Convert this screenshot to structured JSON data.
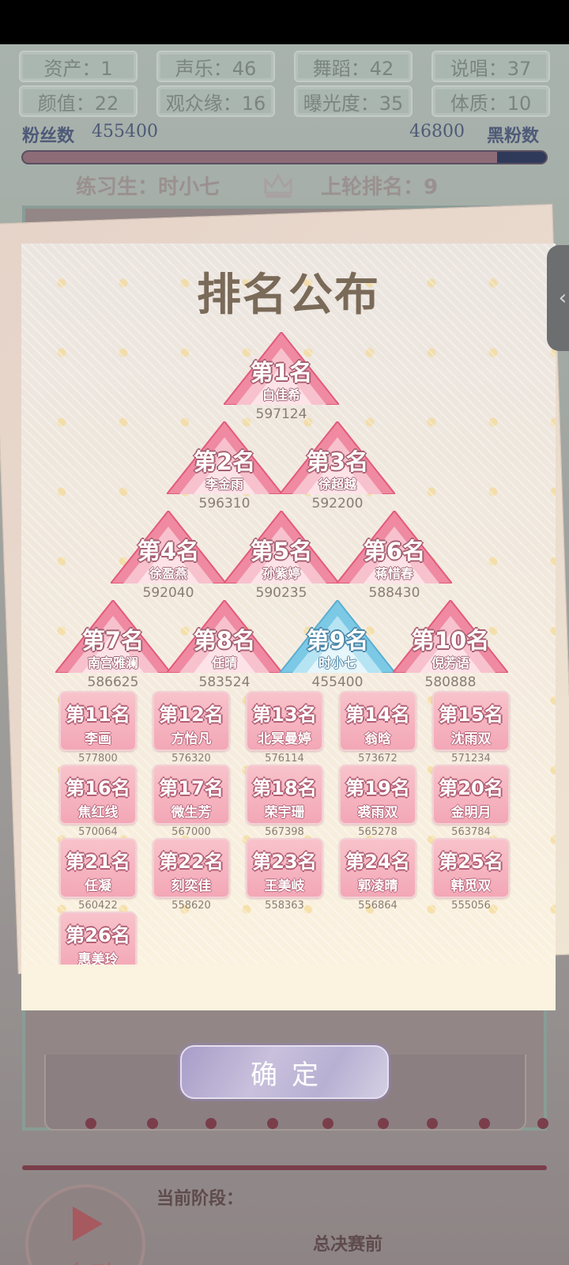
{
  "stats": [
    {
      "label": "资产：1"
    },
    {
      "label": "声乐：46"
    },
    {
      "label": "舞蹈：42"
    },
    {
      "label": "说唱：37"
    },
    {
      "label": "颜值：22"
    },
    {
      "label": "观众缘：16"
    },
    {
      "label": "曝光度：35"
    },
    {
      "label": "体质：10"
    }
  ],
  "fans": {
    "label": "粉丝数",
    "value": "455400",
    "anti_value": "46800",
    "anti_label": "黑粉数",
    "fan_fraction": 0.907
  },
  "trainee": {
    "name_label": "练习生：时小七",
    "last_rank_label": "上轮排名：9"
  },
  "ranking": {
    "title": "排名公布",
    "triangles": [
      {
        "rank": "第1名",
        "name": "白佳希",
        "score": "597124",
        "highlight": false
      },
      {
        "rank": "第2名",
        "name": "李金雨",
        "score": "596310",
        "highlight": false
      },
      {
        "rank": "第3名",
        "name": "徐超越",
        "score": "592200",
        "highlight": false
      },
      {
        "rank": "第4名",
        "name": "徐盈燕",
        "score": "592040",
        "highlight": false
      },
      {
        "rank": "第5名",
        "name": "孙紫婷",
        "score": "590235",
        "highlight": false
      },
      {
        "rank": "第6名",
        "name": "蒋惜春",
        "score": "588430",
        "highlight": false
      },
      {
        "rank": "第7名",
        "name": "南宫雅澜",
        "score": "586625",
        "highlight": false
      },
      {
        "rank": "第8名",
        "name": "任晴",
        "score": "583524",
        "highlight": false
      },
      {
        "rank": "第9名",
        "name": "时小七",
        "score": "455400",
        "highlight": true
      },
      {
        "rank": "第10名",
        "name": "倪芳语",
        "score": "580888",
        "highlight": false
      }
    ],
    "cards": [
      {
        "rank": "第11名",
        "name": "李画",
        "score": "577800"
      },
      {
        "rank": "第12名",
        "name": "方怡凡",
        "score": "576320"
      },
      {
        "rank": "第13名",
        "name": "北冥曼婷",
        "score": "576114"
      },
      {
        "rank": "第14名",
        "name": "翁晗",
        "score": "573672"
      },
      {
        "rank": "第15名",
        "name": "沈雨双",
        "score": "571234"
      },
      {
        "rank": "第16名",
        "name": "焦红线",
        "score": "570064"
      },
      {
        "rank": "第17名",
        "name": "微生芳",
        "score": "567000"
      },
      {
        "rank": "第18名",
        "name": "荣宇珊",
        "score": "567398"
      },
      {
        "rank": "第19名",
        "name": "裘雨双",
        "score": "565278"
      },
      {
        "rank": "第20名",
        "name": "金明月",
        "score": "563784"
      },
      {
        "rank": "第21名",
        "name": "任凝",
        "score": "560422"
      },
      {
        "rank": "第22名",
        "name": "刻奕佳",
        "score": "558620"
      },
      {
        "rank": "第23名",
        "name": "王美岐",
        "score": "558363"
      },
      {
        "rank": "第24名",
        "name": "郭凌晴",
        "score": "556864"
      },
      {
        "rank": "第25名",
        "name": "韩觅双",
        "score": "555056"
      },
      {
        "rank": "第26名",
        "name": "惠美玲",
        "score": ""
      }
    ]
  },
  "confirm_label": "确定",
  "auto_label": "自动",
  "stage": {
    "label": "当前阶段：",
    "value": "总决赛前"
  },
  "side_tab_icon": "chevron-left-icon"
}
